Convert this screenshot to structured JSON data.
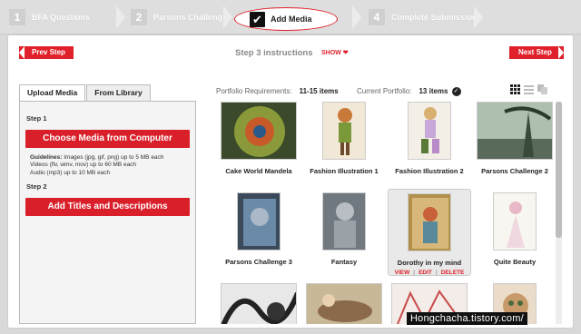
{
  "steps": [
    {
      "num": "1",
      "label": "BFA Questions"
    },
    {
      "num": "2",
      "label": "Parsons Challeng"
    },
    {
      "num": "3",
      "label": "Add Media"
    },
    {
      "num": "4",
      "label": "Complete Submission"
    }
  ],
  "nav": {
    "prev": "Prev Step",
    "next": "Next Step",
    "instructions": "Step 3 instructions",
    "show": "SHOW"
  },
  "upload": {
    "tabs": [
      "Upload Media",
      "From Library"
    ],
    "step1": "Step 1",
    "choose_button": "Choose Media from Computer",
    "guidelines_label": "Guidelines:",
    "guidelines": [
      "Images (jpg, gif, png) up to 5 MB each",
      "Videos (flv, wmv, mov) up to 60 MB each",
      "Audio (mp3) up to 10 MB each"
    ],
    "step2": "Step 2",
    "titles_button": "Add Titles and Descriptions"
  },
  "portfolio": {
    "requirements_label": "Portfolio Requirements:",
    "requirements_value": "11-15 items",
    "current_label": "Current Portfolio:",
    "current_value": "13 items"
  },
  "items": [
    {
      "title": "Cake World Mandela",
      "color": "#6a7a4a"
    },
    {
      "title": "Fashion Illustration 1",
      "color": "#e8d8c0"
    },
    {
      "title": "Fashion Illustration 2",
      "color": "#ece4d6"
    },
    {
      "title": "Parsons Challenge 2",
      "color": "#7a9a7a"
    },
    {
      "title": "Parsons Challenge 3",
      "color": "#58708a"
    },
    {
      "title": "Fantasy",
      "color": "#8a9096"
    },
    {
      "title": "Dorothy in my mind",
      "color": "#c6a46a"
    },
    {
      "title": "Quite Beauty",
      "color": "#f4f2ec"
    }
  ],
  "item_actions": {
    "view": "VIEW",
    "edit": "EDIT",
    "delete": "DELETE"
  },
  "watermark": "Hongchacha.tistory.com/",
  "colors": {
    "accent": "#e0202a"
  }
}
